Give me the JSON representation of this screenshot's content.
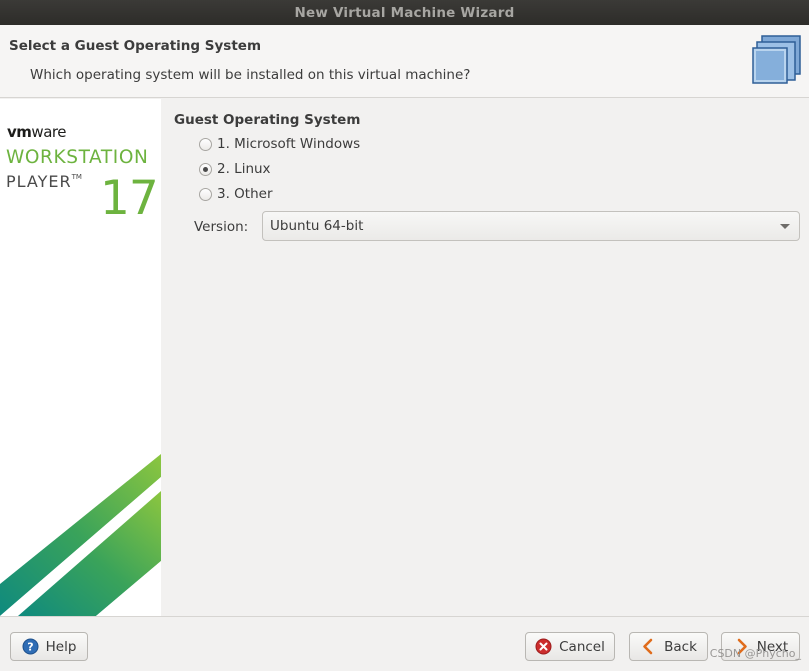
{
  "window": {
    "title": "New Virtual Machine Wizard"
  },
  "header": {
    "title": "Select a Guest Operating System",
    "subtitle": "Which operating system will be installed on this virtual machine?",
    "icon": "vm-wizard-icon"
  },
  "branding": {
    "vendor_prefix": "vm",
    "vendor_suffix": "ware",
    "product_line1": "WORKSTATION",
    "product_line2": "PLAYER",
    "trademark": "TM",
    "version": "17",
    "accent_color": "#6db33f"
  },
  "guest_os": {
    "group_title": "Guest Operating System",
    "options": [
      {
        "label": "1. Microsoft Windows",
        "selected": false
      },
      {
        "label": "2. Linux",
        "selected": true
      },
      {
        "label": "3. Other",
        "selected": false
      }
    ],
    "version_label": "Version:",
    "version_value": "Ubuntu 64-bit"
  },
  "footer": {
    "help_label": "Help",
    "cancel_label": "Cancel",
    "back_label": "Back",
    "next_label": "Next"
  },
  "watermark": "CSDN @Phycho_"
}
